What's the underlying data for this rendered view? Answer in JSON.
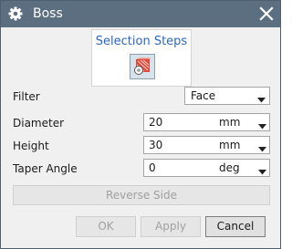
{
  "window": {
    "title": "Boss",
    "title_icon": "gear-icon",
    "close_icon": "close-icon",
    "titlebar_color": "#5b6f80"
  },
  "selection": {
    "title": "Selection Steps",
    "step_icon": "boss-placement-face-icon",
    "accent_color": "#2a66c4"
  },
  "filter": {
    "label": "Filter",
    "value": "Face"
  },
  "parameters": [
    {
      "label": "Diameter",
      "value": "20",
      "unit": "mm"
    },
    {
      "label": "Height",
      "value": "30",
      "unit": "mm"
    },
    {
      "label": "Taper Angle",
      "value": "0",
      "unit": "deg"
    }
  ],
  "reverse_side": {
    "label": "Reverse Side",
    "enabled": false
  },
  "buttons": {
    "ok": {
      "label": "OK",
      "enabled": false
    },
    "apply": {
      "label": "Apply",
      "enabled": false
    },
    "cancel": {
      "label": "Cancel",
      "enabled": true
    }
  }
}
